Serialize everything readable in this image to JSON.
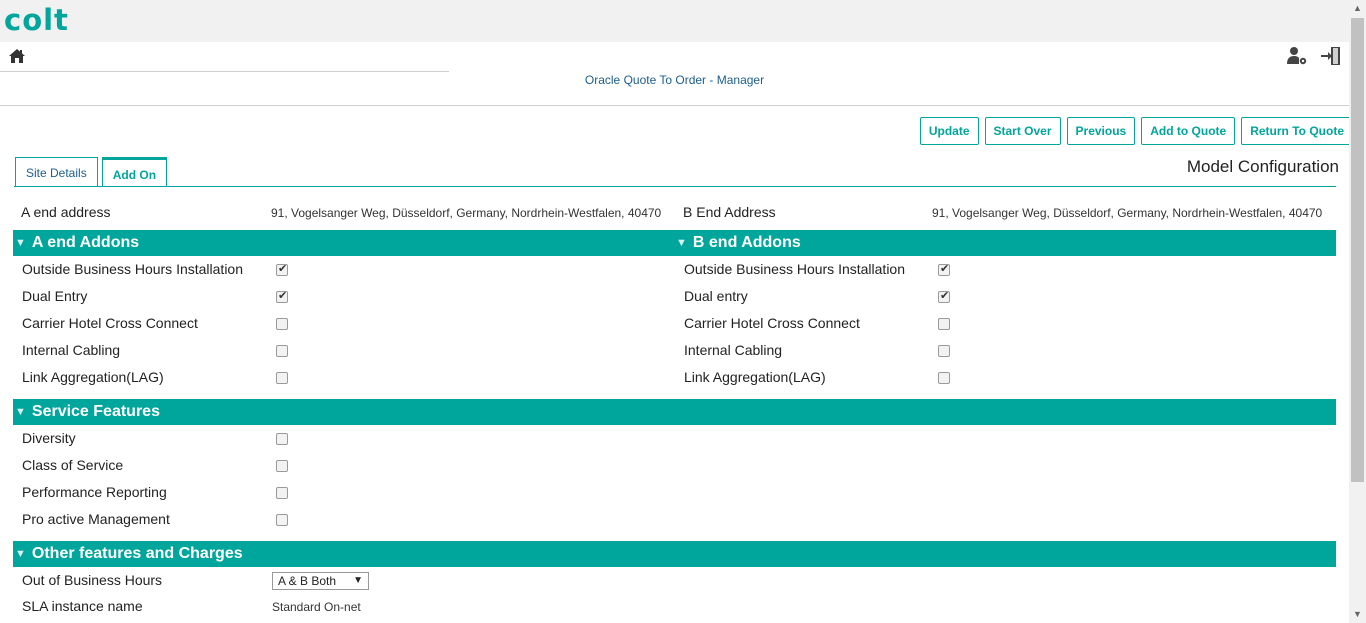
{
  "brand": {
    "logo": "colt"
  },
  "header": {
    "app_title": "Oracle Quote To Order - Manager",
    "icons": [
      "home-icon",
      "user-settings-icon",
      "logout-icon"
    ]
  },
  "actions": {
    "update": "Update",
    "start_over": "Start Over",
    "previous": "Previous",
    "add_to_quote": "Add to Quote",
    "return_to_quote": "Return To Quote"
  },
  "tabs": [
    {
      "label": "Site Details",
      "active": false
    },
    {
      "label": "Add On",
      "active": true
    }
  ],
  "model_title": "Model Configuration",
  "addresses": {
    "a_label": "A end address",
    "a_value": "91, Vogelsanger Weg, Düsseldorf, Germany, Nordrhein-Westfalen, 40470",
    "b_label": "B End Address",
    "b_value": "91, Vogelsanger Weg, Düsseldorf, Germany, Nordrhein-Westfalen, 40470"
  },
  "a_addons": {
    "title": "A end Addons",
    "items": [
      {
        "label": "Outside Business Hours Installation",
        "checked": true
      },
      {
        "label": "Dual Entry",
        "checked": true
      },
      {
        "label": "Carrier Hotel Cross Connect",
        "checked": false
      },
      {
        "label": "Internal Cabling",
        "checked": false
      },
      {
        "label": "Link Aggregation(LAG)",
        "checked": false
      }
    ]
  },
  "b_addons": {
    "title": "B end Addons",
    "items": [
      {
        "label": "Outside Business Hours Installation",
        "checked": true
      },
      {
        "label": "Dual entry",
        "checked": true
      },
      {
        "label": "Carrier Hotel Cross Connect",
        "checked": false
      },
      {
        "label": "Internal Cabling",
        "checked": false
      },
      {
        "label": "Link Aggregation(LAG)",
        "checked": false
      }
    ]
  },
  "service_features": {
    "title": "Service Features",
    "items": [
      {
        "label": "Diversity",
        "checked": false
      },
      {
        "label": "Class of Service",
        "checked": false
      },
      {
        "label": "Performance Reporting",
        "checked": false
      },
      {
        "label": "Pro active Management",
        "checked": false
      }
    ]
  },
  "other_features": {
    "title": "Other features and Charges",
    "out_of_hours_label": "Out of Business Hours",
    "out_of_hours_value": "A & B Both",
    "sla_label": "SLA instance name",
    "sla_value": "Standard On-net"
  },
  "colors": {
    "accent": "#00a59b",
    "link": "#1d5e8c"
  }
}
